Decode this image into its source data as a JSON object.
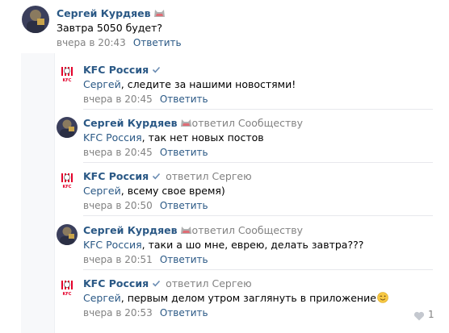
{
  "comments": [
    {
      "author": "Сергей Курдяев",
      "text": "Завтра 5050 будет?",
      "date": "вчера в 20:43",
      "reply": "Ответить"
    },
    {
      "author": "KFC Россия",
      "mention": "Сергей",
      "text": ", следите за нашими новостями!",
      "date": "вчера в 20:45",
      "reply": "Ответить"
    },
    {
      "author": "Сергей Курдяев",
      "replied_to": "ответил Сообществу",
      "mention": "KFC Россия",
      "text": ", так нет новых постов",
      "date": "вчера в 20:45",
      "reply": "Ответить"
    },
    {
      "author": "KFC Россия",
      "replied_to": "ответил Сергею",
      "mention": "Сергей",
      "text": ", всему свое время)",
      "date": "вчера в 20:50",
      "reply": "Ответить"
    },
    {
      "author": "Сергей Курдяев",
      "replied_to": "ответил Сообществу",
      "mention": "KFC Россия",
      "text": ", таки а шо мне, еврею, делать завтра???",
      "date": "вчера в 20:51",
      "reply": "Ответить"
    },
    {
      "author": "KFC Россия",
      "replied_to": "ответил Сергею",
      "mention": "Сергей",
      "text": ", первым делом утром заглянуть в приложение",
      "date": "вчера в 20:53",
      "reply": "Ответить"
    }
  ],
  "like_count": "1",
  "colors": {
    "link": "#2a5885",
    "muted": "#828282",
    "brand_red": "#e4002b"
  }
}
